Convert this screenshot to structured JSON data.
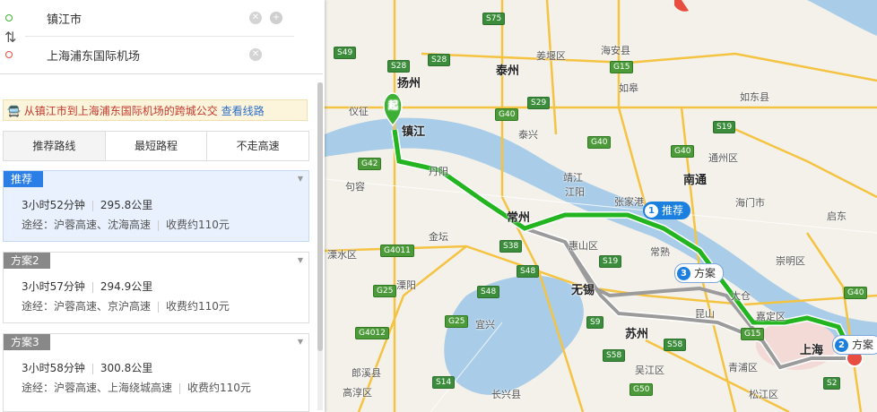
{
  "search": {
    "origin": "镇江市",
    "destination": "上海浦东国际机场"
  },
  "banner": {
    "text": "从镇江市到上海浦东国际机场的跨城公交",
    "link": "查看线路"
  },
  "tabs": [
    "推荐路线",
    "最短路程",
    "不走高速"
  ],
  "plans": [
    {
      "label": "推荐",
      "time": "3小时52分钟",
      "distance": "295.8公里",
      "via": "途经：沪蓉高速、沈海高速",
      "toll": "收费约110元"
    },
    {
      "label": "方案2",
      "time": "3小时57分钟",
      "distance": "294.9公里",
      "via": "途经：沪蓉高速、京沪高速",
      "toll": "收费约110元"
    },
    {
      "label": "方案3",
      "time": "3小时58分钟",
      "distance": "300.8公里",
      "via": "途经：沪蓉高速、上海绕城高速",
      "toll": "收费约110元"
    }
  ],
  "map": {
    "start_marker": "起",
    "route_tags": [
      {
        "num": "1",
        "text": "推荐"
      },
      {
        "num": "3",
        "text": "方案"
      },
      {
        "num": "2",
        "text": "方案"
      }
    ],
    "cities": [
      "扬州",
      "泰州",
      "镇江",
      "常州",
      "南通",
      "无锡",
      "苏州",
      "上海"
    ],
    "places": [
      "仪征",
      "海安县",
      "姜堰区",
      "如皋",
      "如东县",
      "泰兴",
      "靖江",
      "江阳",
      "张家港",
      "通州区",
      "海门市",
      "启东",
      "句容",
      "丹阳",
      "金坛",
      "常熟",
      "崇明区",
      "太仓",
      "嘉定区",
      "昆山",
      "惠山区",
      "宜兴",
      "吴江区",
      "青浦区",
      "松江区",
      "长兴县",
      "溧水区",
      "溧阳",
      "郎溪县",
      "高淳区"
    ],
    "shields": [
      "S75",
      "S49",
      "S28",
      "S28",
      "G15",
      "G40",
      "S29",
      "G40",
      "G40",
      "S19",
      "G42",
      "S38",
      "G4011",
      "S48",
      "S19",
      "G25",
      "S48",
      "G4012",
      "G25",
      "S9",
      "S58",
      "S58",
      "G15",
      "G40",
      "S14",
      "G50",
      "S2"
    ]
  },
  "colors": {
    "route_main": "#22b51f",
    "route_alt": "#9b9b9b",
    "accent": "#1b7fe0"
  }
}
